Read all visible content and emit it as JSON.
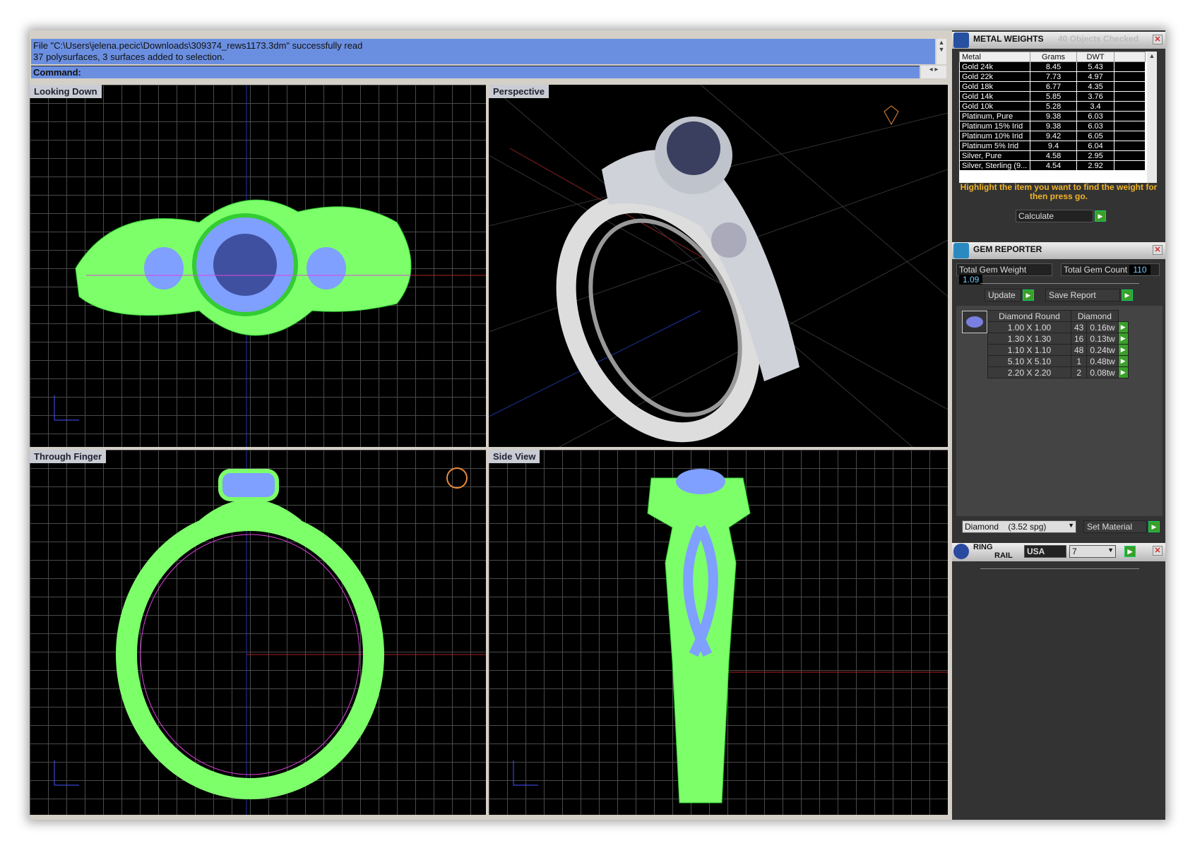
{
  "command": {
    "history": [
      "File \"C:\\Users\\jelena.pecic\\Downloads\\309374_rews1173.3dm\" successfully read",
      "37 polysurfaces, 3 surfaces added to selection."
    ],
    "prompt": "Command:"
  },
  "viewports": [
    {
      "label": "Looking Down",
      "axes": [
        "y",
        "x"
      ]
    },
    {
      "label": "Perspective",
      "axes": [
        "z",
        "y"
      ]
    },
    {
      "label": "Through Finger",
      "axes": [
        "z",
        "x"
      ]
    },
    {
      "label": "Side View",
      "axes": [
        "z",
        "y"
      ]
    }
  ],
  "metal_weights": {
    "title": "METAL WEIGHTS",
    "status": "40 Objects Checked",
    "columns": [
      "Metal",
      "Grams",
      "DWT"
    ],
    "rows": [
      [
        "Gold 24k",
        "8.45",
        "5.43"
      ],
      [
        "Gold 22k",
        "7.73",
        "4.97"
      ],
      [
        "Gold 18k",
        "6.77",
        "4.35"
      ],
      [
        "Gold 14k",
        "5.85",
        "3.76"
      ],
      [
        "Gold 10k",
        "5.28",
        "3.4"
      ],
      [
        "Platinum, Pure",
        "9.38",
        "6.03"
      ],
      [
        "Platinum 15% Irid",
        "9.38",
        "6.03"
      ],
      [
        "Platinum 10% Irid",
        "9.42",
        "6.05"
      ],
      [
        "Platinum 5% Irid",
        "9.4",
        "6.04"
      ],
      [
        "Silver, Pure",
        "4.58",
        "2.95"
      ],
      [
        "Silver, Sterling (9...",
        "4.54",
        "2.92"
      ]
    ],
    "hint": "Highlight the item you want to find the weight for then press go.",
    "calculate": "Calculate"
  },
  "gem_reporter": {
    "title": "GEM REPORTER",
    "total_weight_label": "Total Gem Weight",
    "total_weight": "1.09",
    "total_count_label": "Total Gem Count",
    "total_count": "110",
    "update": "Update",
    "save_report": "Save Report",
    "columns": [
      "Diamond Round",
      "Diamond"
    ],
    "rows": [
      [
        "1.00 X 1.00",
        "43",
        "0.16tw"
      ],
      [
        "1.30 X 1.30",
        "16",
        "0.13tw"
      ],
      [
        "1.10 X 1.10",
        "48",
        "0.24tw"
      ],
      [
        "5.10 X 5.10",
        "1",
        "0.48tw"
      ],
      [
        "2.20 X 2.20",
        "2",
        "0.08tw"
      ]
    ],
    "material": "Diamond    (3.52 spg)",
    "set_material": "Set Material"
  },
  "ring_rail": {
    "title_1": "RING",
    "title_2": "RAIL",
    "country": "USA",
    "size": "7"
  },
  "colors": {
    "command_bg": "#6b8fe0",
    "wire_green": "#7dff6a",
    "gem_blue": "#7fa0ff",
    "hint": "#f0b428",
    "go": "#3aa02a"
  }
}
